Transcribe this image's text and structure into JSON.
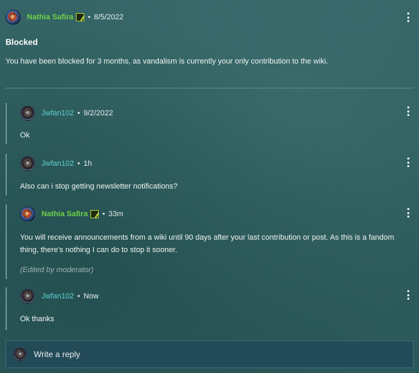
{
  "thread": {
    "author": "Nathia Safira",
    "date": "8/5/2022",
    "title": "Blocked",
    "body": "You have been blocked for 3 months, as vandalism is currently your only contribution to the wiki."
  },
  "replies": [
    {
      "author": "Jwfan102",
      "time": "9/2/2022",
      "body": "Ok",
      "edited": ""
    },
    {
      "author": "Jwfan102",
      "time": "1h",
      "body": "Also can i stop getting newsletter notifications?",
      "edited": ""
    },
    {
      "author": "Nathia Safira",
      "time": "33m",
      "body_line1": "You will receive announcements from a wiki until 90 days after your last contribution or post. As this is a fandom",
      "body_line2": "thing, there's nothing I can do to stop it sooner.",
      "edited": "(Edited by moderator)"
    },
    {
      "author": "Jwfan102",
      "time": "Now",
      "body": "Ok thanks",
      "edited": ""
    }
  ],
  "reply_box": {
    "placeholder": "Write a reply"
  },
  "separator": "•",
  "colors": {
    "staff_name": "#6fd24a",
    "user_name": "#5fd0cf",
    "background": "#2f5e5f"
  },
  "icons": {
    "more": "kebab-menu-icon",
    "badge": "moderator-badge-icon"
  }
}
